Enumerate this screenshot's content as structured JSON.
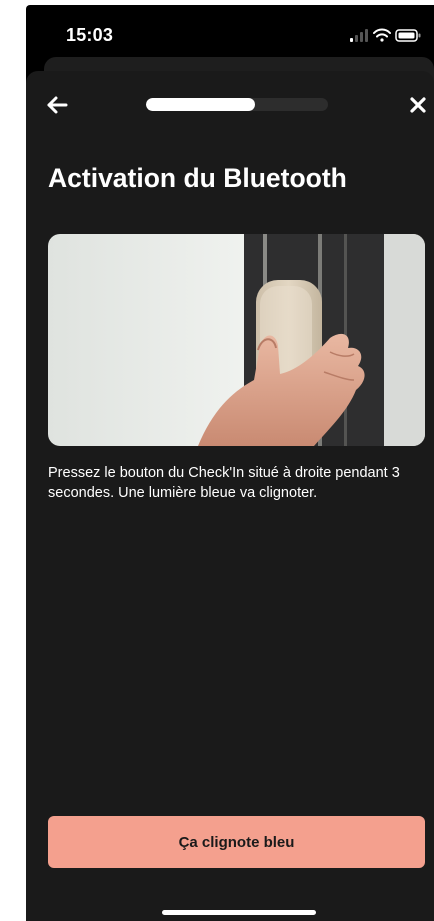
{
  "status_bar": {
    "time": "15:03",
    "icons": [
      "cellular-signal-icon",
      "wifi-icon",
      "battery-icon"
    ]
  },
  "header": {
    "back_icon": "arrow-left-icon",
    "close_icon": "close-icon",
    "progress": 0.6
  },
  "page": {
    "title": "Activation du Bluetooth",
    "image_alt": "Main pressant le bouton du Check'In fixé au cadre de porte",
    "description": "Pressez le bouton du Check'In situé à droite pendant 3 secondes. Une lumière bleue va clignoter."
  },
  "actions": {
    "primary_label": "Ça clignote bleu"
  },
  "colors": {
    "sheet_background": "#1a1a1a",
    "accent_button": "#f4a08e",
    "progress_fill": "#ffffff",
    "progress_track": "#2d2d2d"
  }
}
